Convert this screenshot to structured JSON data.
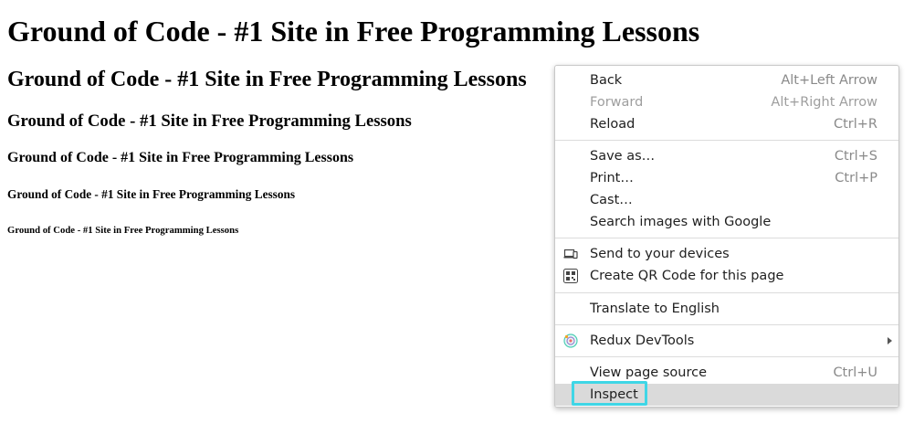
{
  "headings": {
    "h1": "Ground of Code - #1 Site in Free Programming Lessons",
    "h2": "Ground of Code - #1 Site in Free Programming Lessons",
    "h3": "Ground of Code - #1 Site in Free Programming Lessons",
    "h4": "Ground of Code - #1 Site in Free Programming Lessons",
    "h5": "Ground of Code - #1 Site in Free Programming Lessons",
    "h6": "Ground of Code - #1 Site in Free Programming Lessons"
  },
  "context_menu": {
    "back": {
      "label": "Back",
      "shortcut": "Alt+Left Arrow"
    },
    "forward": {
      "label": "Forward",
      "shortcut": "Alt+Right Arrow"
    },
    "reload": {
      "label": "Reload",
      "shortcut": "Ctrl+R"
    },
    "save_as": {
      "label": "Save as…",
      "shortcut": "Ctrl+S"
    },
    "print": {
      "label": "Print…",
      "shortcut": "Ctrl+P"
    },
    "cast": {
      "label": "Cast…"
    },
    "search_images": {
      "label": "Search images with Google"
    },
    "send_devices": {
      "label": "Send to your devices",
      "icon": "devices-icon"
    },
    "qr_code": {
      "label": "Create QR Code for this page",
      "icon": "qr-code-icon"
    },
    "translate": {
      "label": "Translate to English"
    },
    "redux": {
      "label": "Redux DevTools",
      "icon": "redux-devtools-icon"
    },
    "view_source": {
      "label": "View page source",
      "shortcut": "Ctrl+U"
    },
    "inspect": {
      "label": "Inspect"
    }
  },
  "colors": {
    "highlight_border": "#3fd6e6",
    "hover_bg": "#dadada"
  }
}
